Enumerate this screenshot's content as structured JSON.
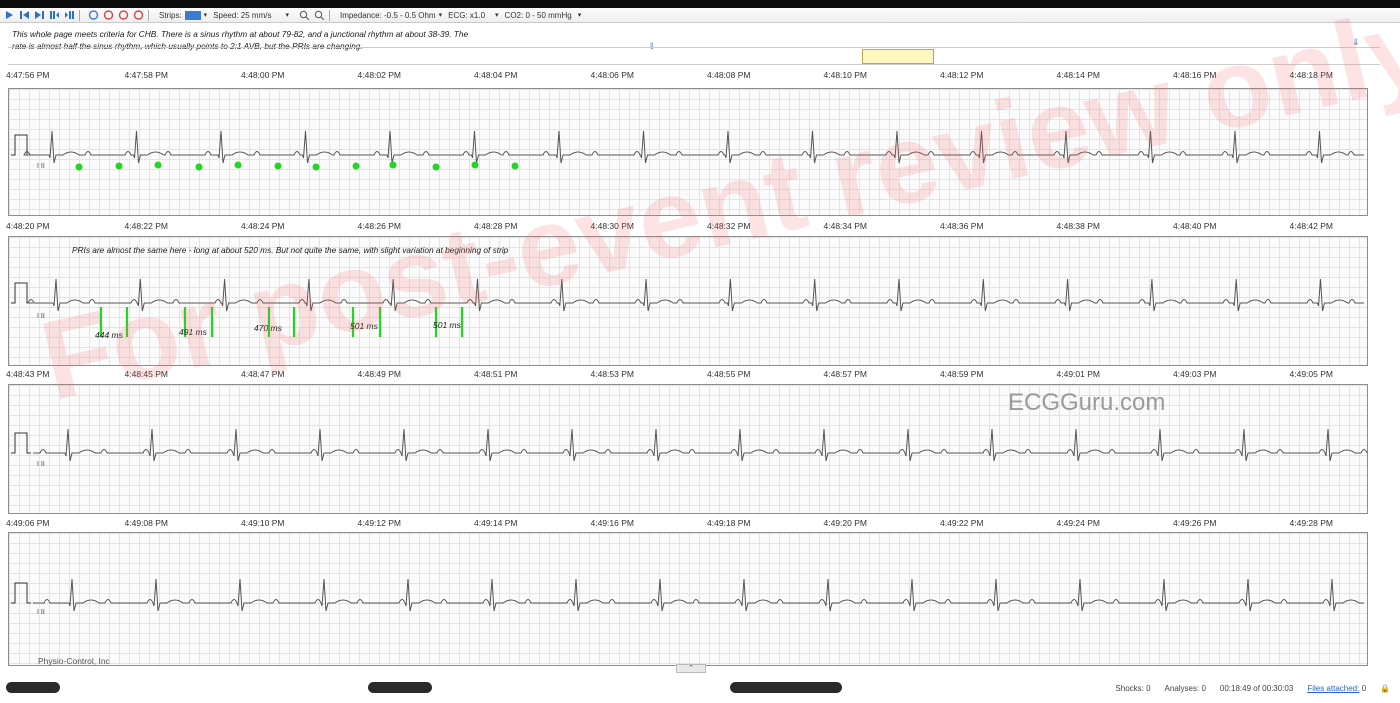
{
  "toolbar": {
    "strips_label": "Strips:",
    "strips_value": "",
    "speed_label": "Speed:",
    "speed_value": "25 mm/s",
    "impedance_label": "Impedance:",
    "impedance_value": "-0.5 - 0.5 Ohm",
    "ecg_label": "ECG:",
    "ecg_value": "x1.0",
    "co2_label": "CO2:",
    "co2_value": "0 - 50 mmHg"
  },
  "annotations": {
    "note1": "This whole page meets criteria for CHB.  There is a sinus rhythm at about 79-82, and a junctional rhythm at about 38-39.  The rate is almost half the sinus rhythm, which usually points to 2:1 AVB, but the PRIs are changing.",
    "note2": "PRIs are almost the same here - long at about 520 ms.  But not quite the same, with slight variation at beginning of strip",
    "pri_labels": [
      "444 ms",
      "491 ms",
      "470 ms",
      "501 ms",
      "501 ms"
    ]
  },
  "strips": [
    {
      "times": [
        "4:47:56 PM",
        "4:47:58 PM",
        "4:48:00 PM",
        "4:48:02 PM",
        "4:48:04 PM",
        "4:48:06 PM",
        "4:48:08 PM",
        "4:48:10 PM",
        "4:48:12 PM",
        "4:48:14 PM",
        "4:48:16 PM",
        "4:48:18 PM"
      ],
      "lead": "I II"
    },
    {
      "times": [
        "4:48:20 PM",
        "4:48:22 PM",
        "4:48:24 PM",
        "4:48:26 PM",
        "4:48:28 PM",
        "4:48:30 PM",
        "4:48:32 PM",
        "4:48:34 PM",
        "4:48:36 PM",
        "4:48:38 PM",
        "4:48:40 PM",
        "4:48:42 PM"
      ],
      "lead": "I II"
    },
    {
      "times": [
        "4:48:43 PM",
        "4:48:45 PM",
        "4:48:47 PM",
        "4:48:49 PM",
        "4:48:51 PM",
        "4:48:53 PM",
        "4:48:55 PM",
        "4:48:57 PM",
        "4:48:59 PM",
        "4:49:01 PM",
        "4:49:03 PM",
        "4:49:05 PM"
      ],
      "lead": "I II"
    },
    {
      "times": [
        "4:49:06 PM",
        "4:49:08 PM",
        "4:49:10 PM",
        "4:49:12 PM",
        "4:49:14 PM",
        "4:49:16 PM",
        "4:49:18 PM",
        "4:49:20 PM",
        "4:49:22 PM",
        "4:49:24 PM",
        "4:49:26 PM",
        "4:49:28 PM"
      ],
      "lead": "I II"
    }
  ],
  "branding": {
    "site": "ECGGuru.com",
    "watermark": "For post-event review only",
    "manufacturer": "Physio-Control, Inc"
  },
  "status": {
    "shocks": "Shocks: 0",
    "analyses": "Analyses: 0",
    "elapsed": "00:18:49 of 00:30:03",
    "files_label": "Files attached:",
    "files_count": "0"
  },
  "colors": {
    "marker_green": "#1fd81f",
    "watermark_red": "#f26262",
    "trace": "#555555"
  },
  "icons": [
    "play-icon",
    "step-icon",
    "skip-icon",
    "zoom-in-icon",
    "zoom-out-icon",
    "lock-icon"
  ]
}
